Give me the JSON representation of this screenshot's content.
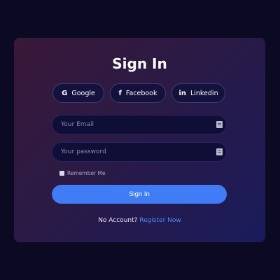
{
  "card": {
    "title": "Sign In"
  },
  "social": [
    {
      "label": "Google",
      "icon": "google-icon",
      "glyph": "G"
    },
    {
      "label": "Facebook",
      "icon": "facebook-icon",
      "glyph": "f"
    },
    {
      "label": "Linkedin",
      "icon": "linkedin-icon",
      "glyph": "in"
    }
  ],
  "form": {
    "email_placeholder": "Your Email",
    "email_value": "",
    "password_placeholder": "Your password",
    "password_value": "",
    "remember_label": "Remember Me",
    "remember_checked": false,
    "submit_label": "Sign In"
  },
  "footer": {
    "prompt": "No Account?",
    "link_label": "Register Now"
  },
  "colors": {
    "accent": "#3f7cf6",
    "link": "#4a8cff",
    "background": "#0b0a22"
  }
}
